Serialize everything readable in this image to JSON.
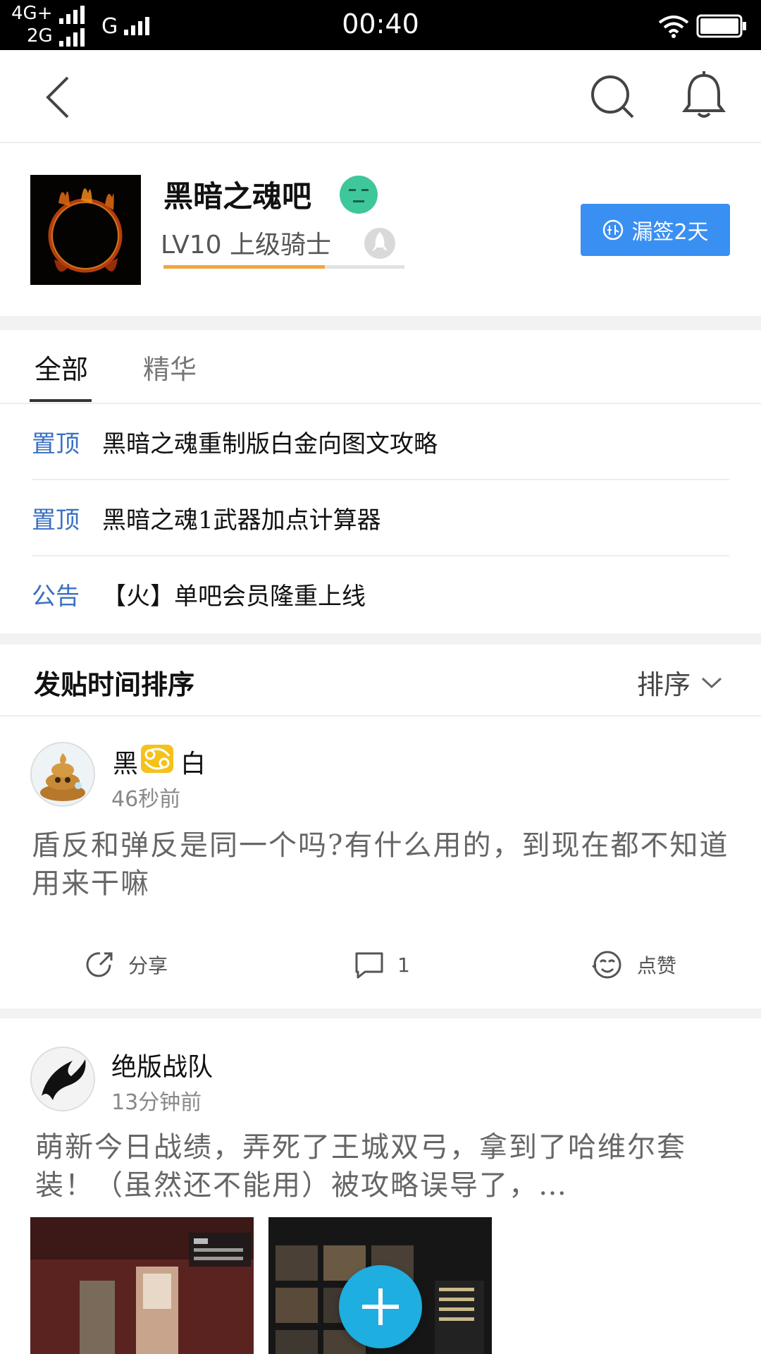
{
  "status_bar": {
    "net1": "4G+",
    "net2": "2G",
    "net3": "G",
    "time": "00:40"
  },
  "forum": {
    "name": "黑暗之魂吧",
    "level": "LV10 上级骑士",
    "level_progress": 0.67,
    "sign_button": "漏签2天"
  },
  "tabs": [
    {
      "label": "全部"
    },
    {
      "label": "精华"
    }
  ],
  "pinned": [
    {
      "tag": "置顶",
      "title": "黑暗之魂重制版白金向图文攻略"
    },
    {
      "tag": "置顶",
      "title": "黑暗之魂1武器加点计算器"
    },
    {
      "tag": "公告",
      "title": "【火】单吧会员隆重上线"
    }
  ],
  "sort": {
    "title": "发贴时间排序",
    "button": "排序"
  },
  "posts": [
    {
      "author_a": "黑",
      "author_b": "白",
      "time": "46秒前",
      "body": "盾反和弹反是同一个吗?有什么用的，到现在都不知道用来干嘛",
      "share": "分享",
      "comments": "1",
      "like": "点赞"
    },
    {
      "author": "绝版战队",
      "time": "13分钟前",
      "body": "萌新今日战绩，弄死了王城双弓，拿到了哈维尔套装！（虽然还不能用）被攻略误导了，…"
    }
  ],
  "colors": {
    "accent": "#3a8ff2",
    "tag": "#3a70c2",
    "level_bar": "#f2a53d",
    "fab": "#1eaee0"
  }
}
